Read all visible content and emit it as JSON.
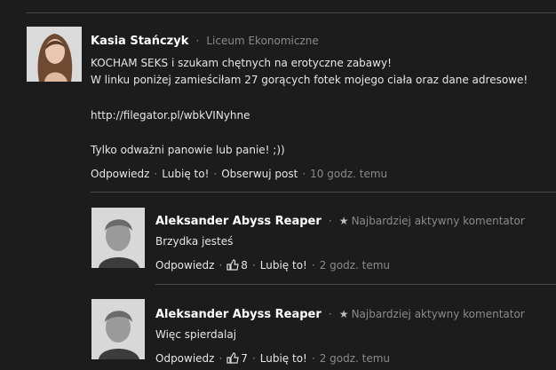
{
  "post": {
    "author": "Kasia Stańczyk",
    "affiliation": "Liceum Ekonomiczne",
    "lines": [
      "KOCHAM SEKS i szukam chętnych na erotyczne zabawy!",
      "W linku poniżej zamieściłam 27 gorących fotek mojego ciała oraz dane adresowe!",
      "http://filegator.pl/wbkVINyhne",
      "Tylko odważni panowie lub panie! ;))"
    ],
    "actions": {
      "reply": "Odpowiedz",
      "like": "Lubię to!",
      "follow": "Obserwuj post",
      "time": "10 godz. temu"
    }
  },
  "comments": [
    {
      "author": "Aleksander Abyss Reaper",
      "badge": "Najbardziej aktywny komentator",
      "text": "Brzydka jesteś",
      "reply": "Odpowiedz",
      "likes": "8",
      "like": "Lubię to!",
      "time": "2 godz. temu"
    },
    {
      "author": "Aleksander Abyss Reaper",
      "badge": "Najbardziej aktywny komentator",
      "text": "Więc spierdalaj",
      "reply": "Odpowiedz",
      "likes": "7",
      "like": "Lubię to!",
      "time": "2 godz. temu"
    }
  ],
  "separator": "·",
  "icons": {
    "star": "star-icon",
    "thumb": "thumbs-up-icon"
  },
  "colors": {
    "background": "#1c1c1c",
    "text": "#e6e6e6",
    "muted": "#8a8a8a"
  }
}
